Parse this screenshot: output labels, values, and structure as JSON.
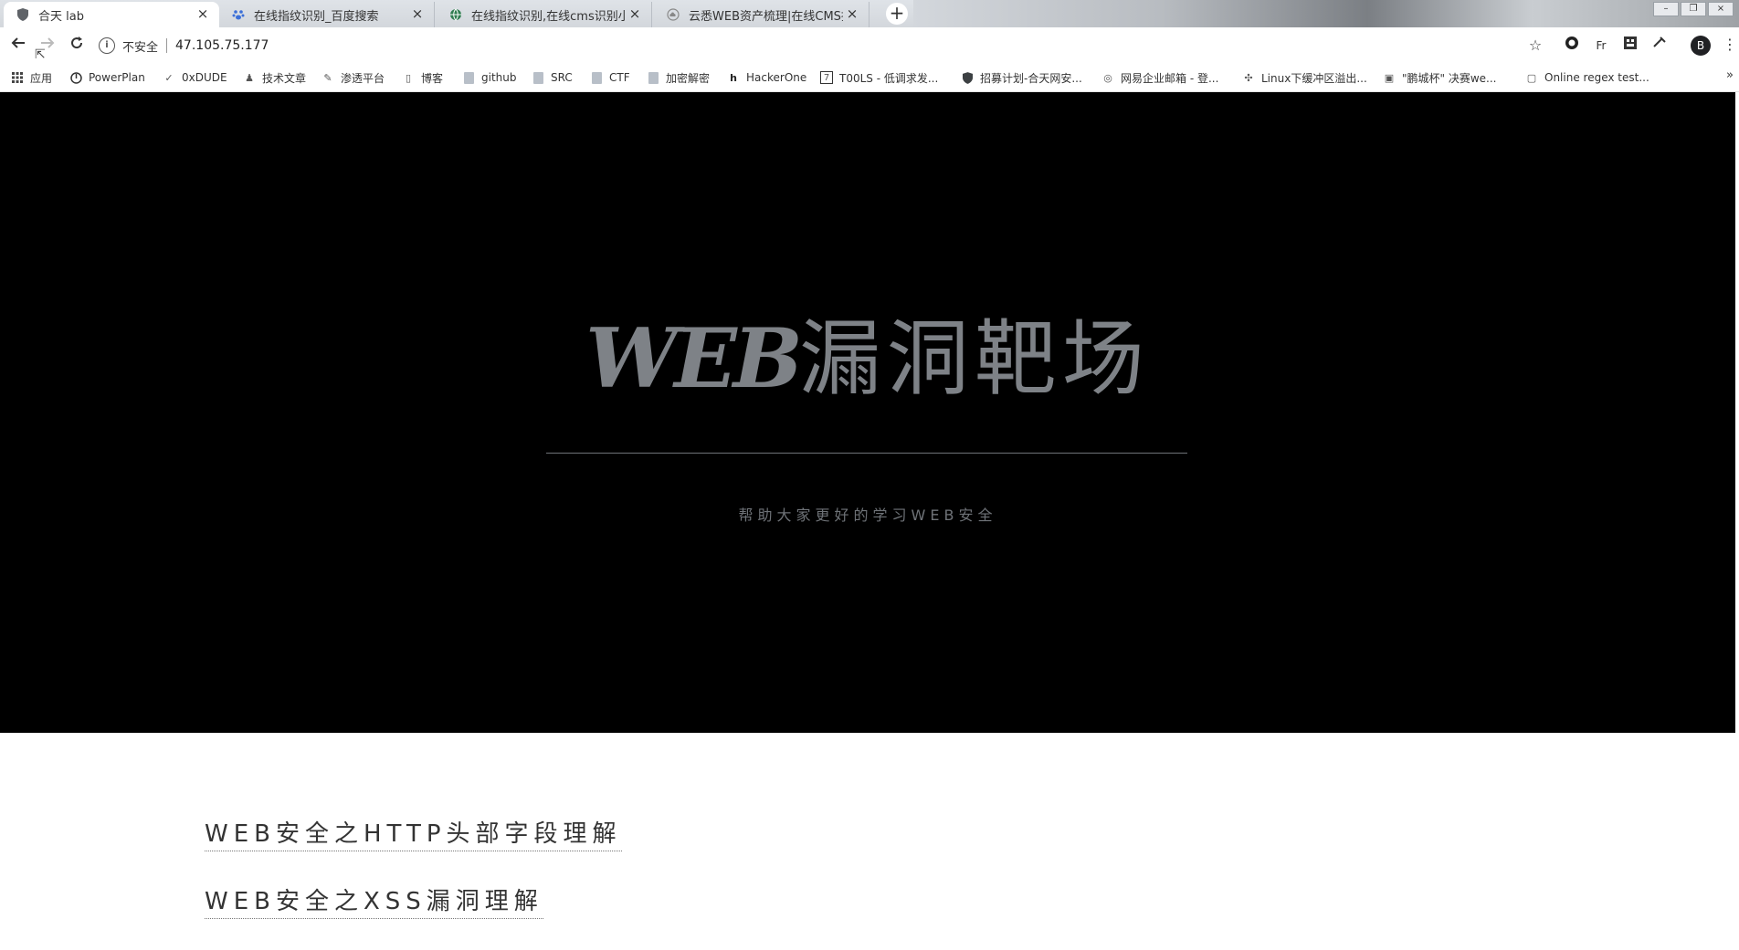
{
  "tabs": [
    {
      "label": "合天 lab",
      "favicon": "shield-icon",
      "active": true
    },
    {
      "label": "在线指纹识别_百度搜索",
      "favicon": "paw-icon",
      "active": false
    },
    {
      "label": "在线指纹识别,在线cms识别小插",
      "favicon": "globe-icon",
      "active": false
    },
    {
      "label": "云悉WEB资产梳理|在线CMS指",
      "favicon": "cloud-icon",
      "active": false
    }
  ],
  "toolbar": {
    "security_label": "不安全",
    "url": "47.105.75.177",
    "profile_initial": "B"
  },
  "bookmarks": [
    {
      "label": "应用",
      "icon": "apps-grid-icon"
    },
    {
      "label": "PowerPlan",
      "icon": "powerplan-icon"
    },
    {
      "label": "0xDUDE",
      "icon": "bookmark-icon"
    },
    {
      "label": "技术文章",
      "icon": "bookmark-icon"
    },
    {
      "label": "渗透平台",
      "icon": "bookmark-icon"
    },
    {
      "label": "博客",
      "icon": "bookmark-icon"
    },
    {
      "label": "github",
      "icon": "folder-icon"
    },
    {
      "label": "SRC",
      "icon": "folder-icon"
    },
    {
      "label": "CTF",
      "icon": "folder-icon"
    },
    {
      "label": "加密解密",
      "icon": "folder-icon"
    },
    {
      "label": "HackerOne",
      "icon": "hackerone-icon"
    },
    {
      "label": "T00LS - 低调求发...",
      "icon": "tools-icon"
    },
    {
      "label": "招募计划-合天网安...",
      "icon": "shield-icon"
    },
    {
      "label": "网易企业邮箱 - 登...",
      "icon": "mail-icon"
    },
    {
      "label": "Linux下缓冲区溢出...",
      "icon": "linux-icon"
    },
    {
      "label": "\"鹏城杯\" 决赛we...",
      "icon": "image-icon"
    },
    {
      "label": "Online regex test...",
      "icon": "regex-icon"
    }
  ],
  "hero": {
    "title_latin": "WEB",
    "title_cjk": "漏洞靶场",
    "subtitle": "帮助大家更好的学习WEB安全"
  },
  "articles": [
    {
      "title": "WEB安全之HTTP头部字段理解"
    },
    {
      "title": "WEB安全之XSS漏洞理解"
    }
  ]
}
